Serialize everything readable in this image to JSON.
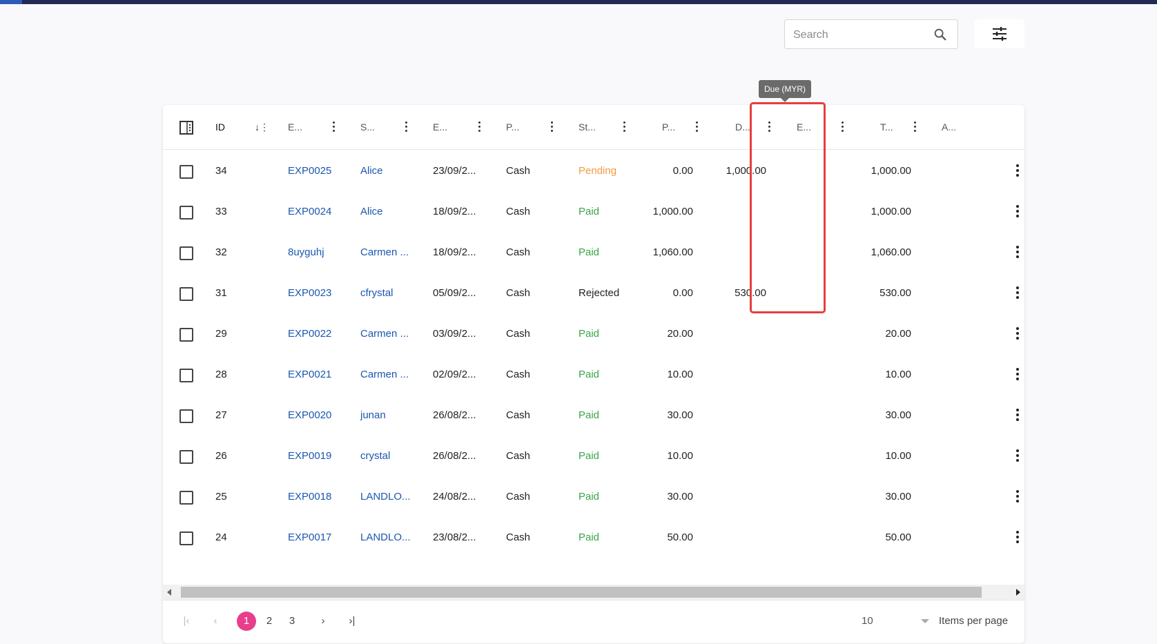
{
  "search": {
    "placeholder": "Search",
    "value": ""
  },
  "tooltip": {
    "text": "Due (MYR)"
  },
  "table": {
    "headers": {
      "id": "ID",
      "expense_no": "E...",
      "supplier": "S...",
      "date": "E...",
      "payment": "P...",
      "status": "St...",
      "paid": "P...",
      "due": "D...",
      "extra": "E...",
      "total": "T...",
      "actions": "A..."
    },
    "rows": [
      {
        "id": "34",
        "expense_no": "EXP0025",
        "supplier": "Alice",
        "date": "23/09/2...",
        "payment": "Cash",
        "status": "Pending",
        "paid": "0.00",
        "due": "1,000.00",
        "extra": "",
        "total": "1,000.00"
      },
      {
        "id": "33",
        "expense_no": "EXP0024",
        "supplier": "Alice",
        "date": "18/09/2...",
        "payment": "Cash",
        "status": "Paid",
        "paid": "1,000.00",
        "due": "",
        "extra": "",
        "total": "1,000.00"
      },
      {
        "id": "32",
        "expense_no": "8uyguhj",
        "supplier": "Carmen ...",
        "date": "18/09/2...",
        "payment": "Cash",
        "status": "Paid",
        "paid": "1,060.00",
        "due": "",
        "extra": "",
        "total": "1,060.00"
      },
      {
        "id": "31",
        "expense_no": "EXP0023",
        "supplier": "cfrystal",
        "date": "05/09/2...",
        "payment": "Cash",
        "status": "Rejected",
        "paid": "0.00",
        "due": "530.00",
        "extra": "",
        "total": "530.00"
      },
      {
        "id": "29",
        "expense_no": "EXP0022",
        "supplier": "Carmen ...",
        "date": "03/09/2...",
        "payment": "Cash",
        "status": "Paid",
        "paid": "20.00",
        "due": "",
        "extra": "",
        "total": "20.00"
      },
      {
        "id": "28",
        "expense_no": "EXP0021",
        "supplier": "Carmen ...",
        "date": "02/09/2...",
        "payment": "Cash",
        "status": "Paid",
        "paid": "10.00",
        "due": "",
        "extra": "",
        "total": "10.00"
      },
      {
        "id": "27",
        "expense_no": "EXP0020",
        "supplier": "junan",
        "date": "26/08/2...",
        "payment": "Cash",
        "status": "Paid",
        "paid": "30.00",
        "due": "",
        "extra": "",
        "total": "30.00"
      },
      {
        "id": "26",
        "expense_no": "EXP0019",
        "supplier": "crystal",
        "date": "26/08/2...",
        "payment": "Cash",
        "status": "Paid",
        "paid": "10.00",
        "due": "",
        "extra": "",
        "total": "10.00"
      },
      {
        "id": "25",
        "expense_no": "EXP0018",
        "supplier": "LANDLO...",
        "date": "24/08/2...",
        "payment": "Cash",
        "status": "Paid",
        "paid": "30.00",
        "due": "",
        "extra": "",
        "total": "30.00"
      },
      {
        "id": "24",
        "expense_no": "EXP0017",
        "supplier": "LANDLO...",
        "date": "23/08/2...",
        "payment": "Cash",
        "status": "Paid",
        "paid": "50.00",
        "due": "",
        "extra": "",
        "total": "50.00"
      }
    ]
  },
  "pagination": {
    "pages": [
      "1",
      "2",
      "3"
    ],
    "current_page": "1",
    "per_page_value": "10",
    "per_page_label": "Items per page"
  },
  "colors": {
    "accent": "#e83e8c",
    "link": "#1b57b0",
    "paid": "#3aa547",
    "pending": "#f19a3e",
    "highlight": "#e53e3e",
    "topbar": "#232a54"
  },
  "icons": {
    "search": "search-icon",
    "filter": "sliders-icon",
    "sort": "sort-desc-icon",
    "column_menu": "vertical-dots-icon"
  }
}
